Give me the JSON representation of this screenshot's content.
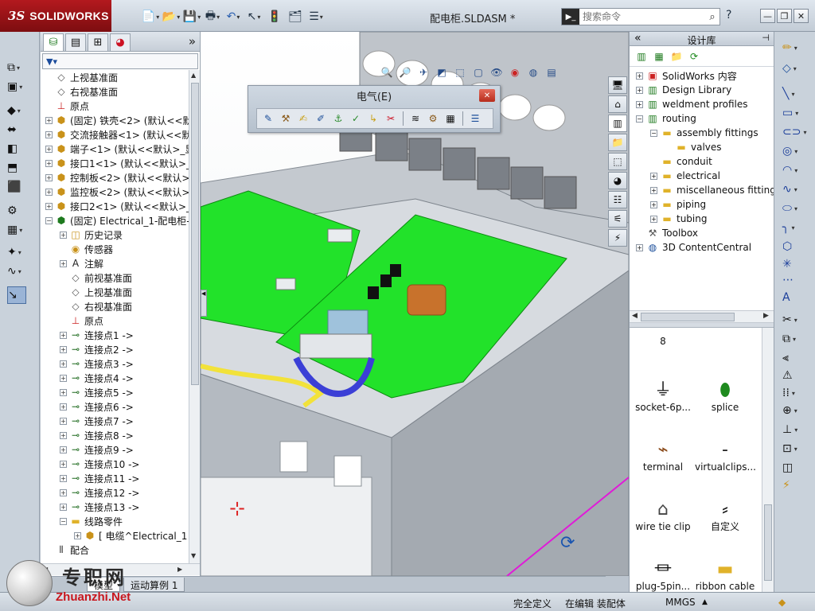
{
  "app": {
    "logo_ds": "3S",
    "logo_name": "SOLIDWORKS",
    "doc_title": "配电柜.SLDASM *"
  },
  "search": {
    "placeholder": "搜索命令"
  },
  "help": "?",
  "window_buttons": {
    "minimize": "—",
    "restore": "❐",
    "close": "✕"
  },
  "feature_manager": {
    "expand_arrow": "»",
    "tree": [
      {
        "label": "上视基准面",
        "indent": 0,
        "icon": "plane"
      },
      {
        "label": "右视基准面",
        "indent": 0,
        "icon": "plane"
      },
      {
        "label": "原点",
        "indent": 0,
        "icon": "origin"
      },
      {
        "label": "(固定) 铁壳<2> (默认<<默",
        "indent": 0,
        "icon": "part",
        "toggle": "+"
      },
      {
        "label": "交流接触器<1> (默认<<默",
        "indent": 0,
        "icon": "part",
        "toggle": "+"
      },
      {
        "label": "端子<1> (默认<<默认>_显",
        "indent": 0,
        "icon": "part",
        "toggle": "+"
      },
      {
        "label": "接口1<1> (默认<<默认>_",
        "indent": 0,
        "icon": "part",
        "toggle": "+"
      },
      {
        "label": "控制板<2> (默认<<默认>_",
        "indent": 0,
        "icon": "part",
        "toggle": "+"
      },
      {
        "label": "监控板<2> (默认<<默认>_",
        "indent": 0,
        "icon": "part",
        "toggle": "+"
      },
      {
        "label": "接口2<1> (默认<<默认>_",
        "indent": 0,
        "icon": "part",
        "toggle": "+"
      },
      {
        "label": "(固定) Electrical_1-配电柜-",
        "indent": 0,
        "icon": "assembly",
        "toggle": "−"
      },
      {
        "label": "历史记录",
        "indent": 1,
        "icon": "history",
        "toggle": "+"
      },
      {
        "label": "传感器",
        "indent": 1,
        "icon": "sensor"
      },
      {
        "label": "注解",
        "indent": 1,
        "icon": "annotation",
        "toggle": "+"
      },
      {
        "label": "前视基准面",
        "indent": 1,
        "icon": "plane"
      },
      {
        "label": "上视基准面",
        "indent": 1,
        "icon": "plane"
      },
      {
        "label": "右视基准面",
        "indent": 1,
        "icon": "plane"
      },
      {
        "label": "原点",
        "indent": 1,
        "icon": "origin"
      },
      {
        "label": "连接点1 ->",
        "indent": 1,
        "icon": "cpoint",
        "toggle": "+"
      },
      {
        "label": "连接点2 ->",
        "indent": 1,
        "icon": "cpoint",
        "toggle": "+"
      },
      {
        "label": "连接点3 ->",
        "indent": 1,
        "icon": "cpoint",
        "toggle": "+"
      },
      {
        "label": "连接点4 ->",
        "indent": 1,
        "icon": "cpoint",
        "toggle": "+"
      },
      {
        "label": "连接点5 ->",
        "indent": 1,
        "icon": "cpoint",
        "toggle": "+"
      },
      {
        "label": "连接点6 ->",
        "indent": 1,
        "icon": "cpoint",
        "toggle": "+"
      },
      {
        "label": "连接点7 ->",
        "indent": 1,
        "icon": "cpoint",
        "toggle": "+"
      },
      {
        "label": "连接点8 ->",
        "indent": 1,
        "icon": "cpoint",
        "toggle": "+"
      },
      {
        "label": "连接点9 ->",
        "indent": 1,
        "icon": "cpoint",
        "toggle": "+"
      },
      {
        "label": "连接点10 ->",
        "indent": 1,
        "icon": "cpoint",
        "toggle": "+"
      },
      {
        "label": "连接点11 ->",
        "indent": 1,
        "icon": "cpoint",
        "toggle": "+"
      },
      {
        "label": "连接点12 ->",
        "indent": 1,
        "icon": "cpoint",
        "toggle": "+"
      },
      {
        "label": "连接点13 ->",
        "indent": 1,
        "icon": "cpoint",
        "toggle": "+"
      },
      {
        "label": "线路零件",
        "indent": 1,
        "icon": "folder",
        "toggle": "−"
      },
      {
        "label": "[ 电缆^Electrical_1",
        "indent": 2,
        "icon": "part",
        "toggle": "+"
      },
      {
        "label": "配合",
        "indent": 0,
        "icon": "mates"
      }
    ]
  },
  "model_tabs": [
    "模型",
    "运动算例 1"
  ],
  "electrical_toolbar": {
    "title": "电气(E)",
    "close": "✕"
  },
  "design_library": {
    "title": "设计库",
    "collapse": "«",
    "pin": "⊣",
    "tree": [
      {
        "label": "SolidWorks 内容",
        "indent": 0,
        "icon": "sw-content",
        "toggle": "+"
      },
      {
        "label": "Design Library",
        "indent": 0,
        "icon": "library",
        "toggle": "+"
      },
      {
        "label": "weldment profiles",
        "indent": 0,
        "icon": "library",
        "toggle": "+"
      },
      {
        "label": "routing",
        "indent": 0,
        "icon": "library",
        "toggle": "−"
      },
      {
        "label": "assembly fittings",
        "indent": 1,
        "icon": "folder",
        "toggle": "−"
      },
      {
        "label": "valves",
        "indent": 2,
        "icon": "folder"
      },
      {
        "label": "conduit",
        "indent": 1,
        "icon": "folder"
      },
      {
        "label": "electrical",
        "indent": 1,
        "icon": "folder",
        "toggle": "+"
      },
      {
        "label": "miscellaneous fitting",
        "indent": 1,
        "icon": "folder",
        "toggle": "+"
      },
      {
        "label": "piping",
        "indent": 1,
        "icon": "folder",
        "toggle": "+"
      },
      {
        "label": "tubing",
        "indent": 1,
        "icon": "folder",
        "toggle": "+"
      },
      {
        "label": "Toolbox",
        "indent": 0,
        "icon": "toolbox"
      },
      {
        "label": "3D ContentCentral",
        "indent": 0,
        "icon": "globe",
        "toggle": "+"
      }
    ],
    "items": [
      {
        "label": "8",
        "icon": "dash"
      },
      {
        "label": "",
        "icon": "dash"
      },
      {
        "label": "socket-6p...",
        "icon": "socket"
      },
      {
        "label": "splice",
        "icon": "splice"
      },
      {
        "label": "terminal",
        "icon": "terminal"
      },
      {
        "label": "virtualclips...",
        "icon": "dash"
      },
      {
        "label": "wire tie clip",
        "icon": "clip"
      },
      {
        "label": "自定义",
        "icon": "custom"
      },
      {
        "label": "plug-5pin...",
        "icon": "plug"
      },
      {
        "label": "ribbon cable",
        "icon": "folder"
      }
    ]
  },
  "status": {
    "defined": "完全定义",
    "editing": "在编辑 装配体",
    "units": "MMGS",
    "units_arrow": "▲"
  },
  "watermark": {
    "text": "专职网",
    "url": "Zhuanzhi.Net"
  },
  "colors": {
    "logo_red": "#b3191e",
    "pcb_green": "#22e22a",
    "cabinet_gray": "#b9bec5",
    "wire_yellow": "#f2e23a",
    "wire_blue": "#3b3fd6"
  }
}
